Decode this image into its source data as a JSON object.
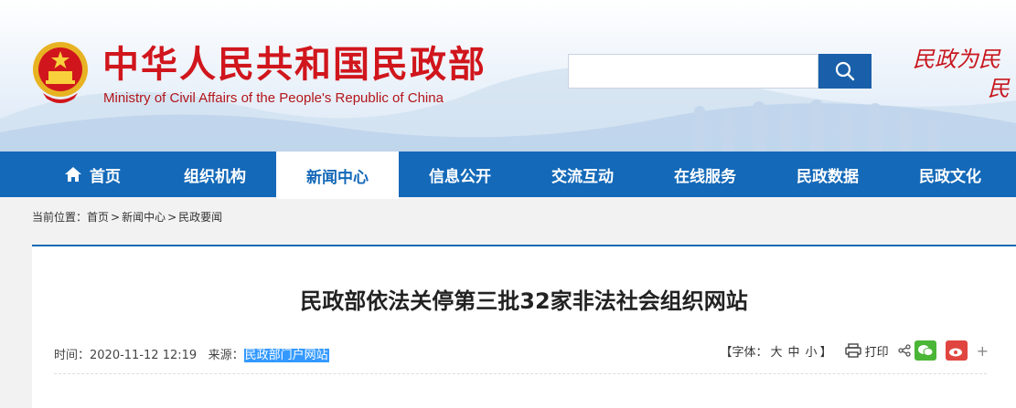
{
  "header": {
    "title": "中华人民共和国民政部",
    "subtitle": "Ministry of Civil Affairs of the People's Republic of China",
    "search_placeholder": "",
    "slogan_line1": "民政为民",
    "slogan_line2": "民"
  },
  "nav": {
    "items": [
      {
        "label": "首页",
        "icon": "home-icon"
      },
      {
        "label": "组织机构"
      },
      {
        "label": "新闻中心",
        "active": true
      },
      {
        "label": "信息公开"
      },
      {
        "label": "交流互动"
      },
      {
        "label": "在线服务"
      },
      {
        "label": "民政数据"
      },
      {
        "label": "民政文化"
      }
    ]
  },
  "breadcrumb": {
    "prefix": "当前位置：",
    "items": [
      "首页",
      "新闻中心",
      "民政要闻"
    ],
    "separator": ">"
  },
  "article": {
    "title": "民政部依法关停第三批32家非法社会组织网站",
    "time_label": "时间：",
    "time_value": "2020-11-12 12:19",
    "source_label": "来源：",
    "source_value": "民政部门户网站",
    "font_label_open": "【字体：",
    "font_large": "大",
    "font_medium": "中",
    "font_small": "小",
    "font_label_close": "】",
    "print_label": "打印",
    "more_label": "+"
  },
  "colors": {
    "nav_bg": "#1469b8",
    "title_red": "#d0161c",
    "search_btn": "#1a5fa9",
    "wechat": "#4ab536",
    "weibo": "#e0463f"
  }
}
